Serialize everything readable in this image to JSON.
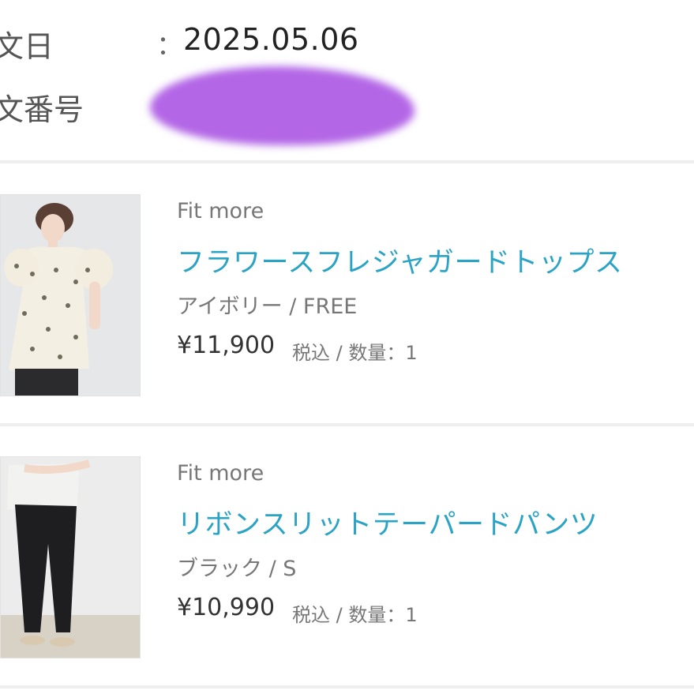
{
  "order": {
    "date_label": "文日",
    "date_separator": "：",
    "date_value": "2025.05.06",
    "number_label": "文番号"
  },
  "items": [
    {
      "brand": "Fit more",
      "name": "フラワースフレジャガードトップス",
      "variant": "アイボリー / FREE",
      "price": "¥11,900",
      "tax_qty": "税込 / 数量：1",
      "image": "ivory-floral-blouse-photo"
    },
    {
      "brand": "Fit more",
      "name": "リボンスリットテーパードパンツ",
      "variant": "ブラック / S",
      "price": "¥10,990",
      "tax_qty": "税込 / 数量：1",
      "image": "black-tapered-pants-photo"
    }
  ],
  "colors": {
    "link": "#2aa3c4",
    "redaction": "#b366e6",
    "divider": "#eeeeee"
  }
}
